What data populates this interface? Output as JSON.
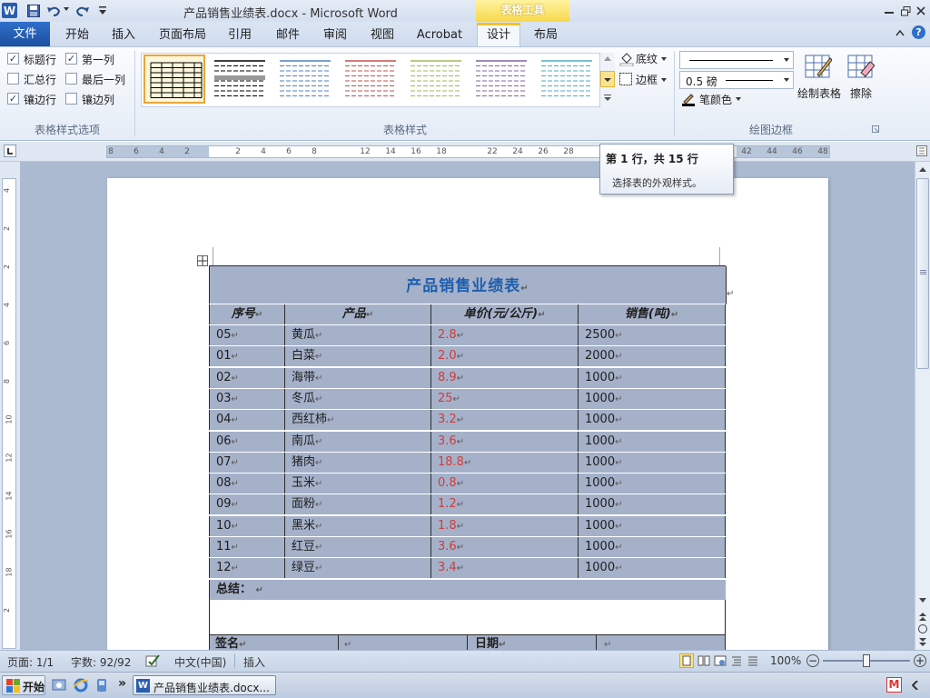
{
  "window": {
    "title": "产品销售业绩表.docx - Microsoft Word",
    "context_tab": "表格工具",
    "app_icon": "W",
    "controls": [
      "minimize-icon",
      "restore-icon",
      "close-icon"
    ]
  },
  "tabs": [
    {
      "label": "文件"
    },
    {
      "label": "开始"
    },
    {
      "label": "插入"
    },
    {
      "label": "页面布局"
    },
    {
      "label": "引用"
    },
    {
      "label": "邮件"
    },
    {
      "label": "审阅"
    },
    {
      "label": "视图"
    },
    {
      "label": "Acrobat"
    },
    {
      "label": "设计"
    },
    {
      "label": "布局"
    }
  ],
  "ribbon": {
    "style_options": {
      "group_label": "表格样式选项",
      "options": [
        {
          "label": "标题行",
          "checked": true
        },
        {
          "label": "第一列",
          "checked": true
        },
        {
          "label": "汇总行",
          "checked": false
        },
        {
          "label": "最后一列",
          "checked": false
        },
        {
          "label": "镶边行",
          "checked": true
        },
        {
          "label": "镶边列",
          "checked": false
        }
      ]
    },
    "table_styles": {
      "group_label": "表格样式",
      "thumb_colors": [
        "#000000",
        "#000000",
        "#4f81bd",
        "#c0504d",
        "#9bbb59",
        "#8064a2",
        "#4bacc6"
      ],
      "shading_label": "底纹",
      "borders_label": "边框"
    },
    "draw_borders": {
      "group_label": "绘图边框",
      "pen_weight": "0.5 磅",
      "pen_color_label": "笔颜色",
      "draw_table_label": "绘制表格",
      "eraser_label": "擦除"
    }
  },
  "ruler": {
    "labels": [
      "8",
      "6",
      "4",
      "2",
      "2",
      "4",
      "6",
      "8",
      "12",
      "14",
      "16",
      "18",
      "22",
      "24",
      "26",
      "28",
      "42",
      "44",
      "46",
      "48"
    ],
    "vlabels": [
      "4",
      "2",
      "2",
      "4",
      "6",
      "8",
      "10",
      "12",
      "14",
      "16",
      "18",
      "2"
    ]
  },
  "tooltip": {
    "title": "第 1 行，共 15 行",
    "body": "选择表的外观样式。"
  },
  "document": {
    "table_title": "产品销售业绩表",
    "headers": [
      "序号",
      "产品",
      "单价(元/公斤)",
      "销售(吨)"
    ],
    "rows": [
      [
        "05",
        "黄瓜",
        "2.8",
        "2500"
      ],
      [
        "01",
        "白菜",
        "2.0",
        "2000"
      ],
      [
        "02",
        "海带",
        "8.9",
        "1000"
      ],
      [
        "03",
        "冬瓜",
        "25",
        "1000"
      ],
      [
        "04",
        "西红柿",
        "3.2",
        "1000"
      ],
      [
        "06",
        "南瓜",
        "3.6",
        "1000"
      ],
      [
        "07",
        "猪肉",
        "18.8",
        "1000"
      ],
      [
        "08",
        "玉米",
        "0.8",
        "1000"
      ],
      [
        "09",
        "面粉",
        "1.2",
        "1000"
      ],
      [
        "10",
        "黑米",
        "1.8",
        "1000"
      ],
      [
        "11",
        "红豆",
        "3.6",
        "1000"
      ],
      [
        "12",
        "绿豆",
        "3.4",
        "1000"
      ]
    ],
    "summary_label": "总结：",
    "signature_label": "签名",
    "date_label": "日期",
    "paragraph_mark": "↵",
    "colors": {
      "row_fill": "#a5b1c9",
      "price_text": "#d23c3c",
      "title_text": "#1f5fae"
    }
  },
  "status": {
    "page": "页面: 1/1",
    "words": "字数: 92/92",
    "language": "中文(中国)",
    "mode": "插入",
    "zoom": "100%"
  },
  "taskbar": {
    "start_label": "开始",
    "task_label": "产品销售业绩表.docx...",
    "chevron": "»"
  }
}
